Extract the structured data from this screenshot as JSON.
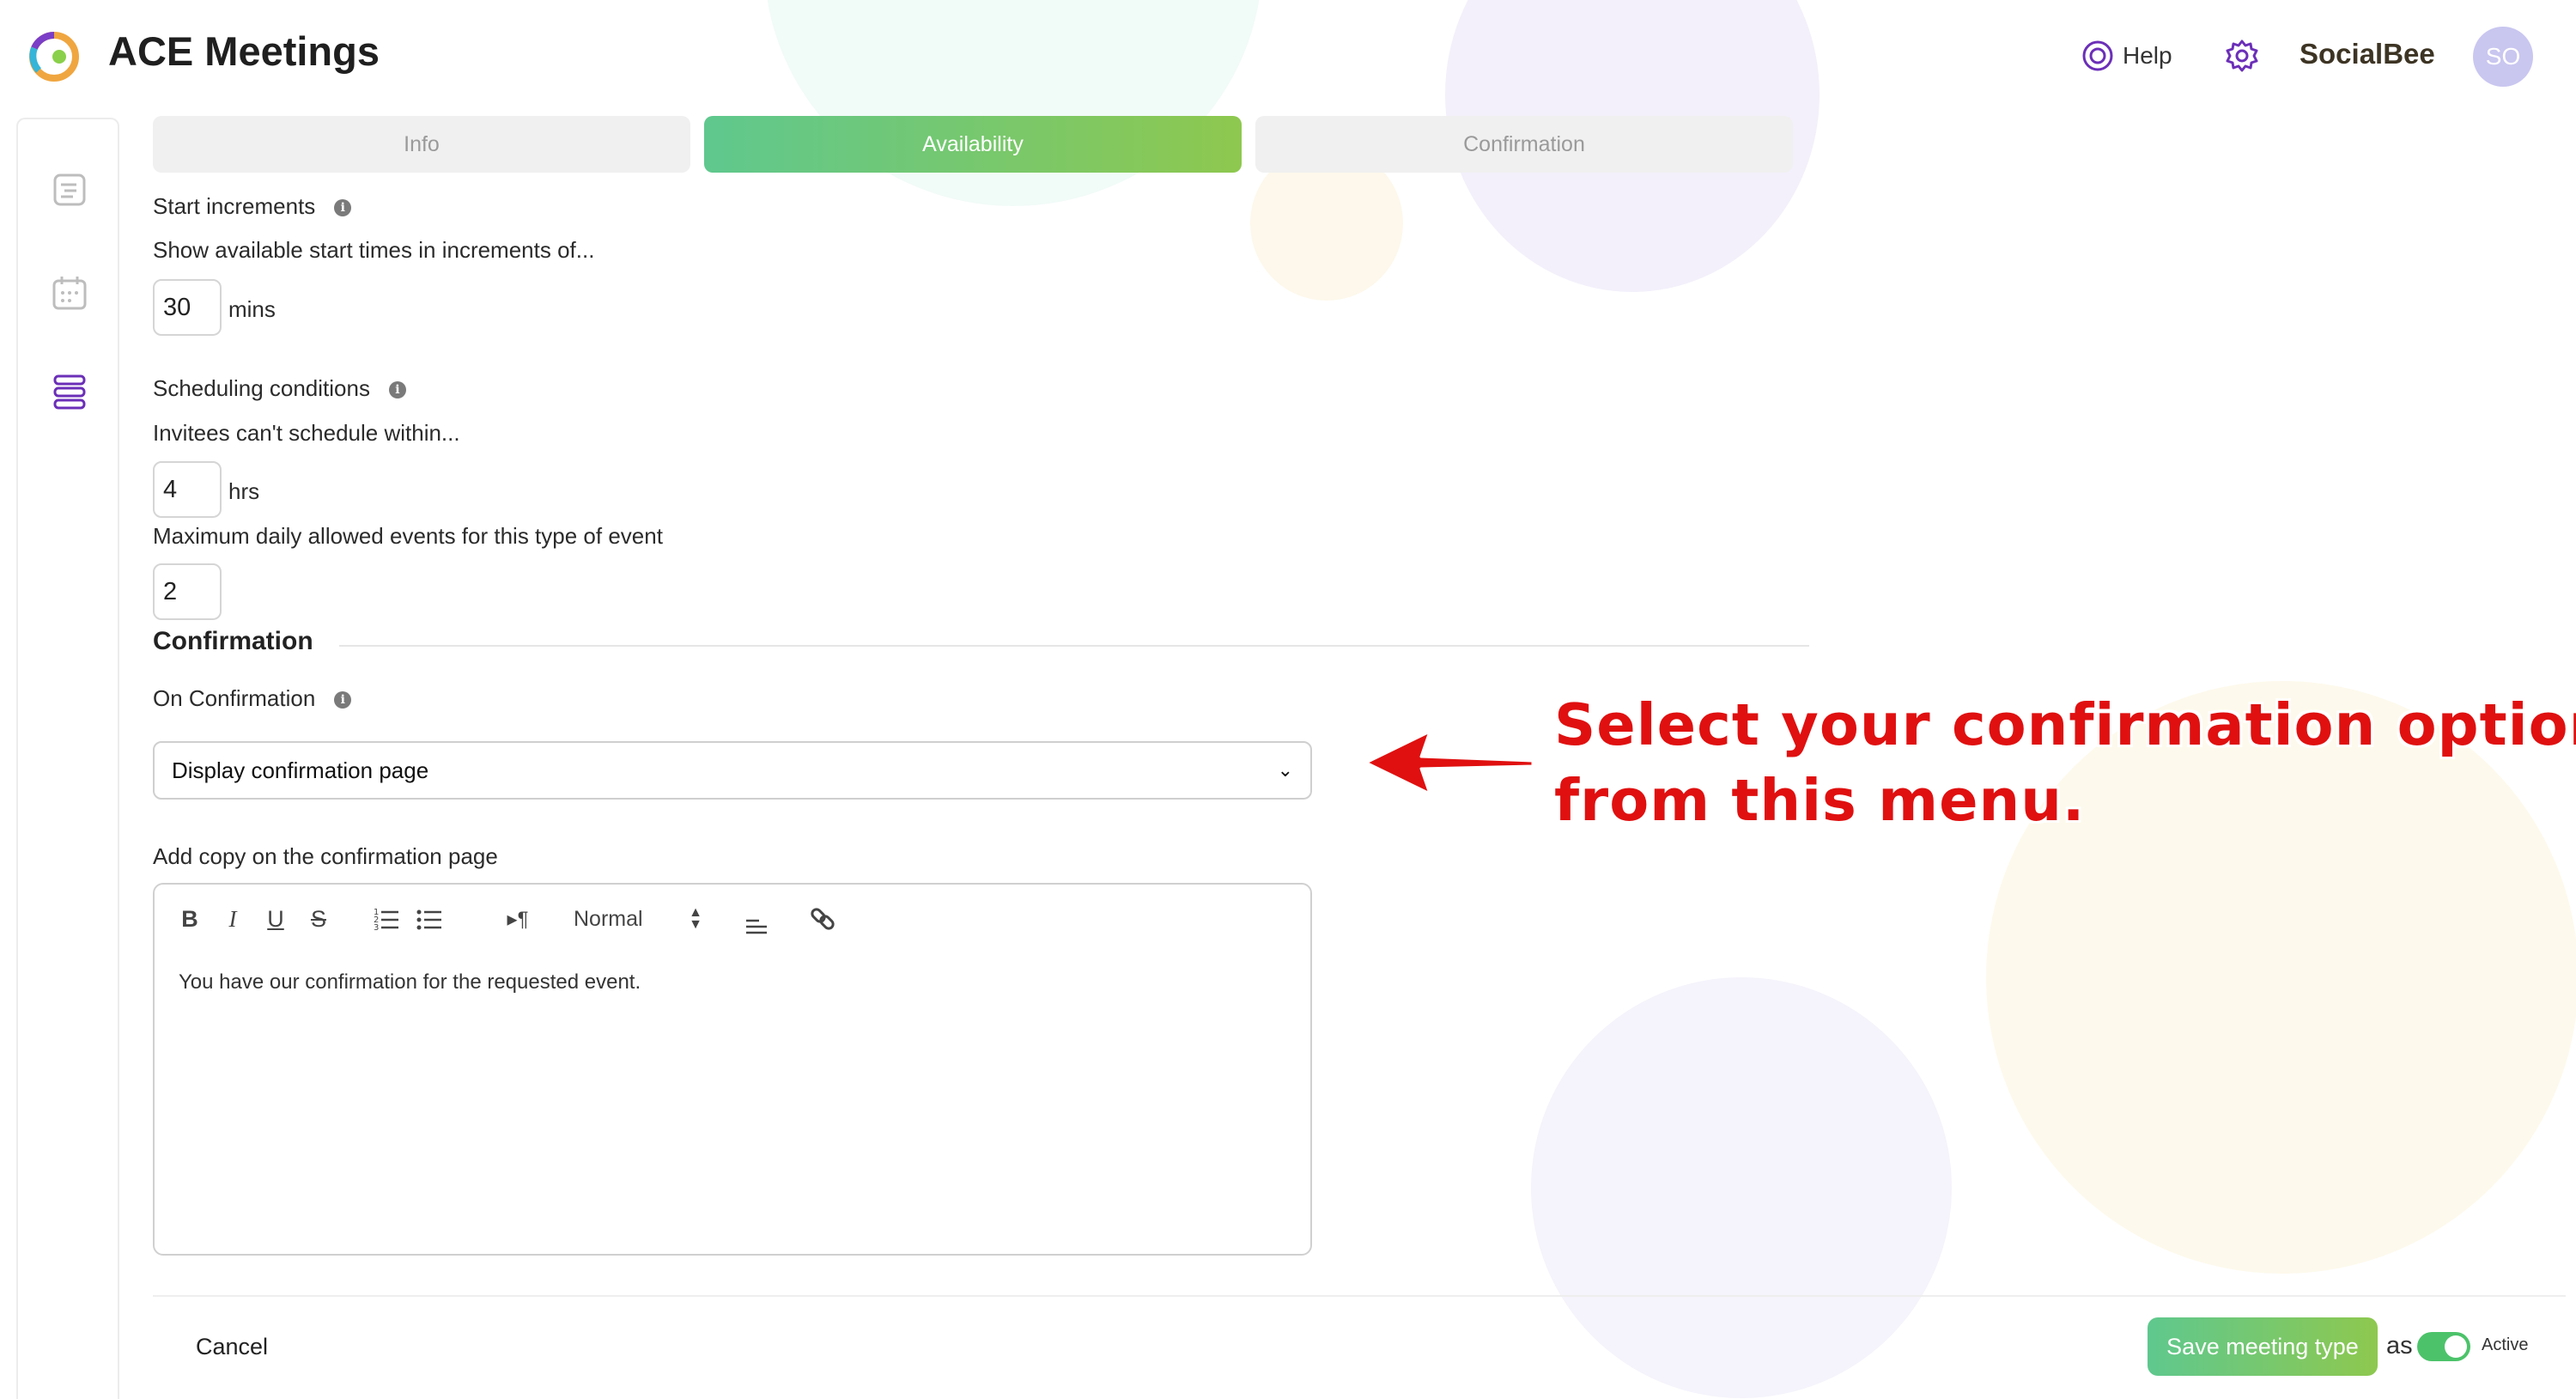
{
  "header": {
    "app_title": "ACE Meetings",
    "help_label": "Help",
    "brand_name": "SocialBee",
    "avatar_initials": "SO"
  },
  "sidebar": {
    "items": [
      {
        "icon": "list-icon"
      },
      {
        "icon": "calendar-icon"
      },
      {
        "icon": "meeting-types-icon",
        "active": true
      }
    ]
  },
  "tabs": [
    {
      "label": "Info",
      "active": false
    },
    {
      "label": "Availability",
      "active": true
    },
    {
      "label": "Confirmation",
      "active": false
    }
  ],
  "availability": {
    "start_increments_title": "Start increments",
    "start_increments_desc": "Show available start times in increments of...",
    "start_increments_value": "30",
    "start_increments_unit": "mins",
    "scheduling_title": "Scheduling conditions",
    "scheduling_desc": "Invitees can't schedule within...",
    "scheduling_value": "4",
    "scheduling_unit": "hrs",
    "max_daily_label": "Maximum daily allowed events for this type of event",
    "max_daily_value": "2"
  },
  "confirmation": {
    "section_title": "Confirmation",
    "on_confirmation_label": "On Confirmation",
    "selected_option": "Display confirmation page",
    "copy_label": "Add copy on the confirmation page",
    "editor_text": "You have our confirmation for the requested event.",
    "format_select": "Normal"
  },
  "annotation": {
    "line1": "Select your confirmation option",
    "line2": "from this menu."
  },
  "footer": {
    "cancel_label": "Cancel",
    "save_label": "Save meeting type",
    "as_label": "as",
    "active_label": "Active",
    "active_on": true
  },
  "colors": {
    "accent_start": "#5fc88e",
    "accent_end": "#8ec84f",
    "annotation_red": "#e01010",
    "brand_purple": "#6b2fb8"
  }
}
